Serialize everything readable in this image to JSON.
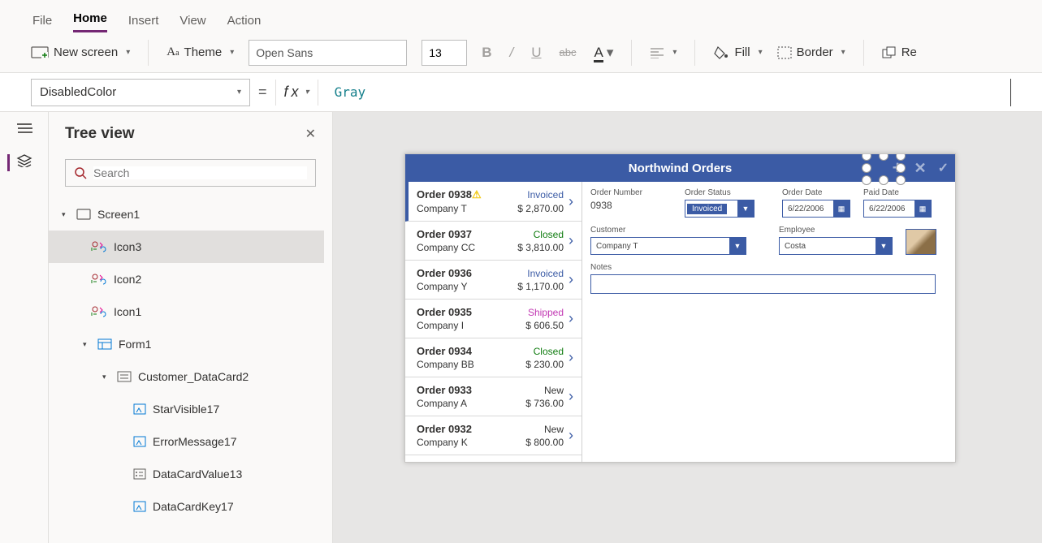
{
  "menu": {
    "file": "File",
    "home": "Home",
    "insert": "Insert",
    "view": "View",
    "action": "Action"
  },
  "ribbon": {
    "newscreen": "New screen",
    "theme": "Theme",
    "font": "Open Sans",
    "size": "13",
    "fill": "Fill",
    "border": "Border",
    "reorder": "Re"
  },
  "property": "DisabledColor",
  "formula": "Gray",
  "panel": {
    "title": "Tree view",
    "searchPlaceholder": "Search"
  },
  "tree": {
    "screen": "Screen1",
    "icon3": "Icon3",
    "icon2": "Icon2",
    "icon1": "Icon1",
    "form": "Form1",
    "card": "Customer_DataCard2",
    "child1": "StarVisible17",
    "child2": "ErrorMessage17",
    "child3": "DataCardValue13",
    "child4": "DataCardKey17"
  },
  "app": {
    "title": "Northwind Orders",
    "orders": [
      {
        "id": "Order 0938",
        "company": "Company T",
        "price": "$ 2,870.00",
        "status": "Invoiced",
        "color": "#3b5ba5",
        "warn": true,
        "sel": true
      },
      {
        "id": "Order 0937",
        "company": "Company CC",
        "price": "$ 3,810.00",
        "status": "Closed",
        "color": "#107c10"
      },
      {
        "id": "Order 0936",
        "company": "Company Y",
        "price": "$ 1,170.00",
        "status": "Invoiced",
        "color": "#3b5ba5"
      },
      {
        "id": "Order 0935",
        "company": "Company I",
        "price": "$ 606.50",
        "status": "Shipped",
        "color": "#c239b3"
      },
      {
        "id": "Order 0934",
        "company": "Company BB",
        "price": "$ 230.00",
        "status": "Closed",
        "color": "#107c10"
      },
      {
        "id": "Order 0933",
        "company": "Company A",
        "price": "$ 736.00",
        "status": "New",
        "color": "#333"
      },
      {
        "id": "Order 0932",
        "company": "Company K",
        "price": "$ 800.00",
        "status": "New",
        "color": "#333"
      }
    ],
    "detail": {
      "orderNumberLabel": "Order Number",
      "orderNumber": "0938",
      "orderStatusLabel": "Order Status",
      "orderStatus": "Invoiced",
      "orderDateLabel": "Order Date",
      "orderDate": "6/22/2006",
      "paidDateLabel": "Paid Date",
      "paidDate": "6/22/2006",
      "customerLabel": "Customer",
      "customer": "Company T",
      "employeeLabel": "Employee",
      "employee": "Costa",
      "notesLabel": "Notes"
    }
  }
}
